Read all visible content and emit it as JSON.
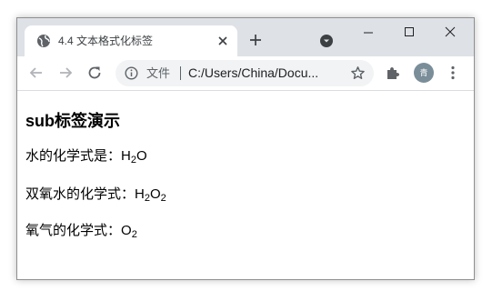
{
  "tab": {
    "title": "4.4 文本格式化标签"
  },
  "omnibox": {
    "chip": "文件",
    "url": "C:/Users/China/Docu..."
  },
  "profile": {
    "avatar_text": "青"
  },
  "page": {
    "heading": "sub标签演示",
    "lines": [
      {
        "label": "水的化学式是：",
        "parts": [
          "H",
          "2",
          "O"
        ]
      },
      {
        "label": "双氧水的化学式：",
        "parts": [
          "H",
          "2",
          "O",
          "2"
        ]
      },
      {
        "label": "氧气的化学式：",
        "parts": [
          "O",
          "2"
        ]
      }
    ]
  },
  "icons": {
    "favicon": "globe-icon",
    "tab_close": "close-icon",
    "new_tab": "plus-icon",
    "tab_search": "tab-search-icon",
    "minimize": "minimize-icon",
    "maximize": "maximize-icon",
    "window_close": "close-icon",
    "back": "arrow-left-icon",
    "forward": "arrow-right-icon",
    "reload": "reload-icon",
    "site_info": "info-icon",
    "bookmark": "star-icon",
    "extensions": "puzzle-icon",
    "menu": "kebab-menu-icon"
  }
}
